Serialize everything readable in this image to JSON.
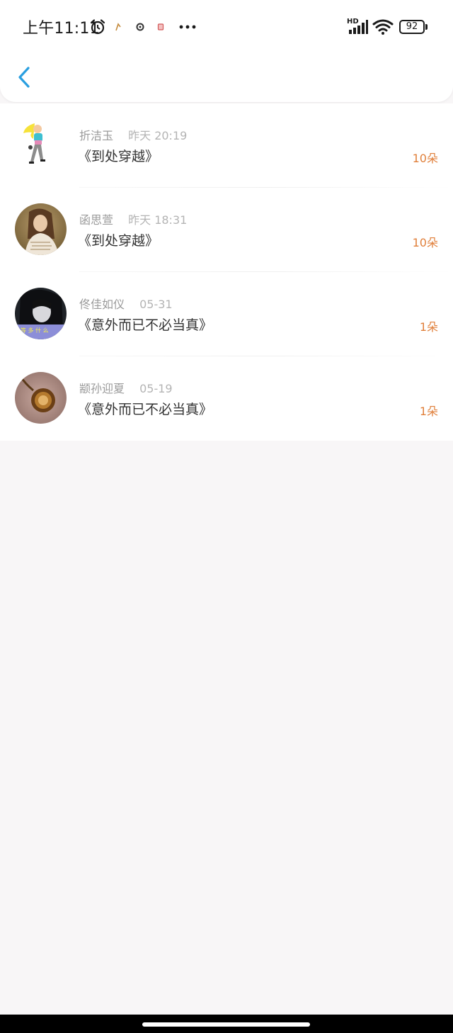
{
  "status_bar": {
    "time": "上午11:11",
    "hd": "HD",
    "battery": "92",
    "icons": [
      "alarm-clock-icon",
      "notification-icon",
      "notification-icon",
      "notification-icon",
      "more-dots-icon",
      "signal-icon",
      "wifi-icon",
      "battery-icon"
    ]
  },
  "nav": {
    "back_icon": "chevron-left-icon",
    "accent": "#2a9fe0"
  },
  "gifts": [
    {
      "name": "折洁玉",
      "time": "昨天 20:19",
      "title": "《到处穿越》",
      "amount": "10朵"
    },
    {
      "name": "函思萱",
      "time": "昨天 18:31",
      "title": "《到处穿越》",
      "amount": "10朵"
    },
    {
      "name": "佟佳如仪",
      "time": "05-31",
      "title": "《意外而已不必当真》",
      "amount": "1朵"
    },
    {
      "name": "颛孙迎夏",
      "time": "05-19",
      "title": "《意外而已不必当真》",
      "amount": "1朵"
    }
  ],
  "colors": {
    "amount": "#e07f3a",
    "background": "#f8f6f7"
  }
}
